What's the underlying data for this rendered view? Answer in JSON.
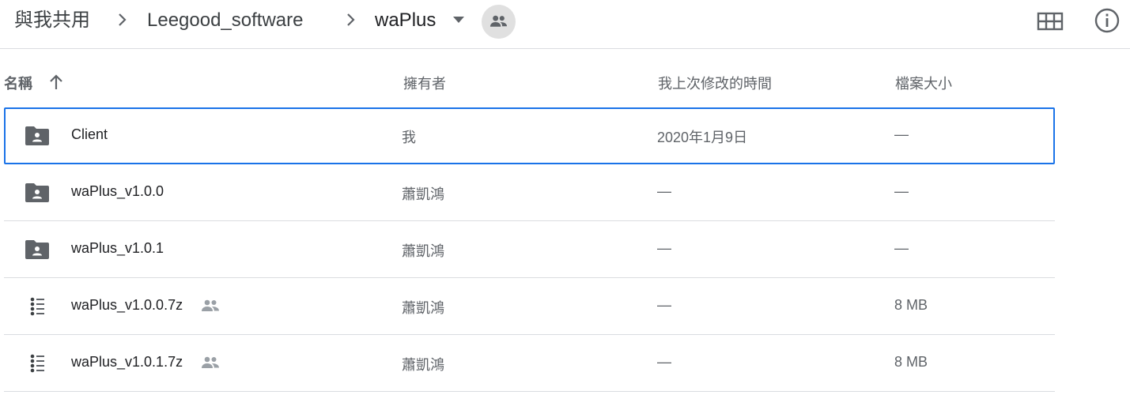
{
  "breadcrumb": {
    "root": "與我共用",
    "folder": "Leegood_software",
    "current": "waPlus"
  },
  "toolbar": {
    "shared_icon": "people-icon",
    "grid_view_icon": "grid-view-icon",
    "info_icon": "info-icon"
  },
  "columns": {
    "name": "名稱",
    "owner": "擁有者",
    "modified": "我上次修改的時間",
    "size": "檔案大小"
  },
  "files": [
    {
      "name": "Client",
      "type": "shared-folder",
      "owner": "我",
      "modified": "2020年1月9日",
      "size": "—",
      "shared": false,
      "selected": true
    },
    {
      "name": "waPlus_v1.0.0",
      "type": "shared-folder",
      "owner": "蕭凱鴻",
      "modified": "—",
      "size": "—",
      "shared": false,
      "selected": false
    },
    {
      "name": "waPlus_v1.0.1",
      "type": "shared-folder",
      "owner": "蕭凱鴻",
      "modified": "—",
      "size": "—",
      "shared": false,
      "selected": false
    },
    {
      "name": "waPlus_v1.0.0.7z",
      "type": "archive",
      "owner": "蕭凱鴻",
      "modified": "—",
      "size": "8 MB",
      "shared": true,
      "selected": false
    },
    {
      "name": "waPlus_v1.0.1.7z",
      "type": "archive",
      "owner": "蕭凱鴻",
      "modified": "—",
      "size": "8 MB",
      "shared": true,
      "selected": false
    }
  ],
  "colors": {
    "accent": "#1a73e8",
    "icon": "#5f6368",
    "divider": "#dadce0"
  }
}
